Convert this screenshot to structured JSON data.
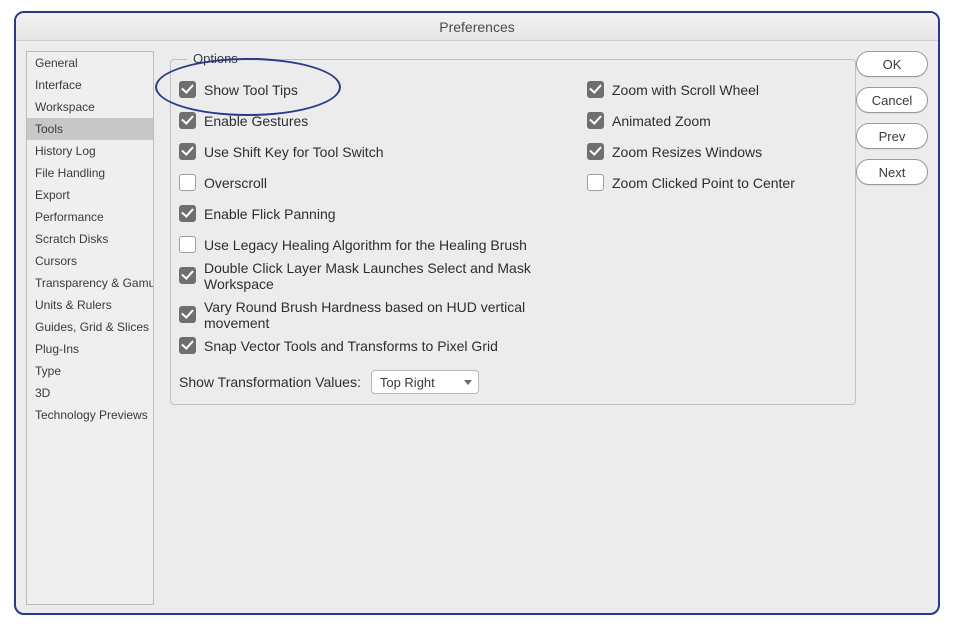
{
  "title": "Preferences",
  "sidebar": {
    "items": [
      {
        "label": "General",
        "selected": false
      },
      {
        "label": "Interface",
        "selected": false
      },
      {
        "label": "Workspace",
        "selected": false
      },
      {
        "label": "Tools",
        "selected": true
      },
      {
        "label": "History Log",
        "selected": false
      },
      {
        "label": "File Handling",
        "selected": false
      },
      {
        "label": "Export",
        "selected": false
      },
      {
        "label": "Performance",
        "selected": false
      },
      {
        "label": "Scratch Disks",
        "selected": false
      },
      {
        "label": "Cursors",
        "selected": false
      },
      {
        "label": "Transparency & Gamut",
        "selected": false
      },
      {
        "label": "Units & Rulers",
        "selected": false
      },
      {
        "label": "Guides, Grid & Slices",
        "selected": false
      },
      {
        "label": "Plug-Ins",
        "selected": false
      },
      {
        "label": "Type",
        "selected": false
      },
      {
        "label": "3D",
        "selected": false
      },
      {
        "label": "Technology Previews",
        "selected": false
      }
    ]
  },
  "panel": {
    "title": "Options",
    "left": [
      {
        "key": "show_tooltips",
        "label": "Show Tool Tips",
        "checked": true
      },
      {
        "key": "enable_gestures",
        "label": "Enable Gestures",
        "checked": true
      },
      {
        "key": "shift_tool_switch",
        "label": "Use Shift Key for Tool Switch",
        "checked": true
      },
      {
        "key": "overscroll",
        "label": "Overscroll",
        "checked": false
      },
      {
        "key": "flick_panning",
        "label": "Enable Flick Panning",
        "checked": true
      },
      {
        "key": "legacy_healing",
        "label": "Use Legacy Healing Algorithm for the Healing Brush",
        "checked": false
      },
      {
        "key": "dbl_click_layer_mask",
        "label": "Double Click Layer Mask Launches Select and Mask Workspace",
        "checked": true
      },
      {
        "key": "vary_brush_hardness",
        "label": "Vary Round Brush Hardness based on HUD vertical movement",
        "checked": true
      },
      {
        "key": "snap_vector",
        "label": "Snap Vector Tools and Transforms to Pixel Grid",
        "checked": true
      }
    ],
    "right": [
      {
        "key": "zoom_scroll_wheel",
        "label": "Zoom with Scroll Wheel",
        "checked": true
      },
      {
        "key": "animated_zoom",
        "label": "Animated Zoom",
        "checked": true
      },
      {
        "key": "zoom_resizes_windows",
        "label": "Zoom Resizes Windows",
        "checked": true
      },
      {
        "key": "zoom_click_center",
        "label": "Zoom Clicked Point to Center",
        "checked": false
      }
    ],
    "select": {
      "label": "Show Transformation Values:",
      "value": "Top Right"
    }
  },
  "buttons": {
    "ok": "OK",
    "cancel": "Cancel",
    "prev": "Prev",
    "next": "Next"
  },
  "emphasis": {
    "target": "show_tooltips"
  }
}
